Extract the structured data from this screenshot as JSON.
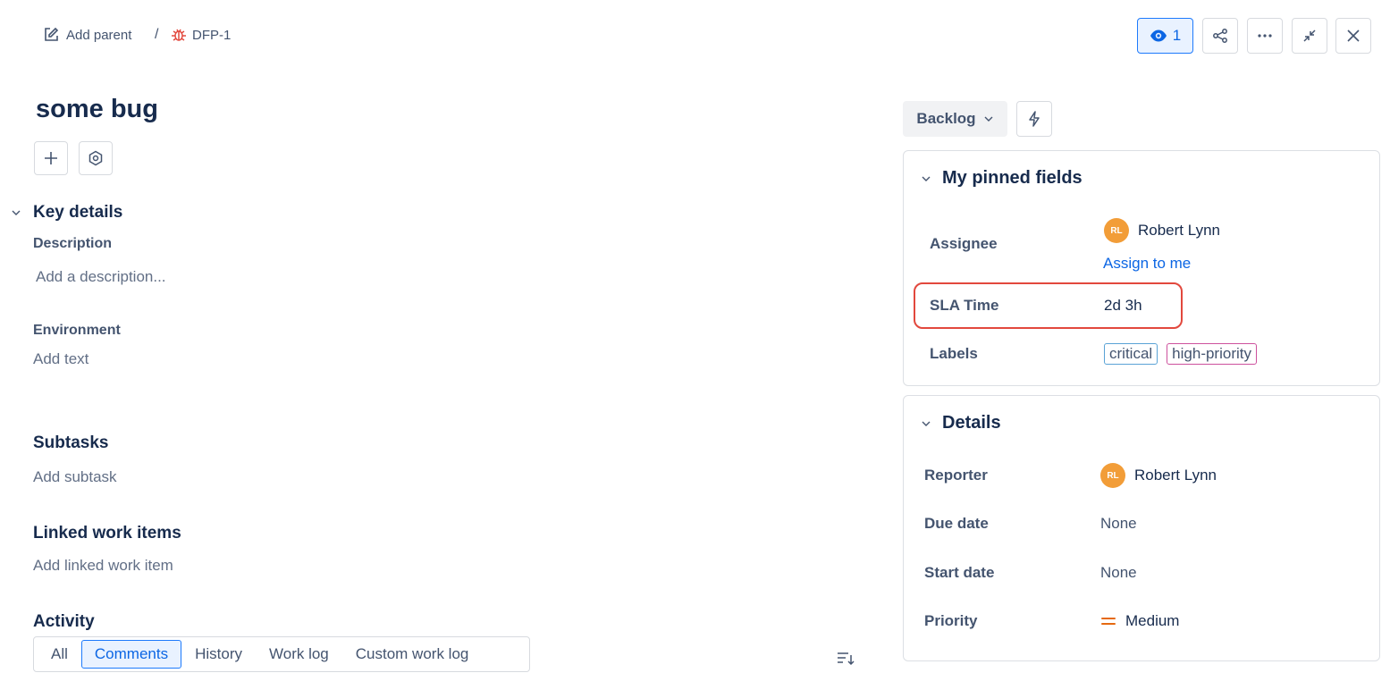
{
  "breadcrumb": {
    "add_parent": "Add parent",
    "separator": "/",
    "issue_key": "DFP-1"
  },
  "toolbar": {
    "watch_count": "1",
    "icons": [
      "eye-icon",
      "share-icon",
      "more-icon",
      "minimize-icon",
      "close-icon"
    ]
  },
  "issue": {
    "title": "some bug"
  },
  "key_details": {
    "heading": "Key details",
    "description_label": "Description",
    "description_placeholder": "Add a description...",
    "environment_label": "Environment",
    "environment_placeholder": "Add text"
  },
  "subtasks": {
    "heading": "Subtasks",
    "action": "Add subtask"
  },
  "linked": {
    "heading": "Linked work items",
    "action": "Add linked work item"
  },
  "activity": {
    "heading": "Activity",
    "tabs": [
      "All",
      "Comments",
      "History",
      "Work log",
      "Custom work log"
    ],
    "active_tab": "Comments"
  },
  "status": {
    "label": "Backlog"
  },
  "pinned": {
    "heading": "My pinned fields",
    "assignee_label": "Assignee",
    "assignee_initials": "RL",
    "assignee_name": "Robert Lynn",
    "assign_to_me": "Assign to me",
    "sla_label": "SLA Time",
    "sla_value": "2d 3h",
    "labels_label": "Labels",
    "labels": [
      "critical",
      "high-priority"
    ]
  },
  "details": {
    "heading": "Details",
    "reporter_label": "Reporter",
    "reporter_initials": "RL",
    "reporter_name": "Robert Lynn",
    "due_label": "Due date",
    "due_value": "None",
    "start_label": "Start date",
    "start_value": "None",
    "priority_label": "Priority",
    "priority_value": "Medium"
  },
  "colors": {
    "accent": "#0c66e4",
    "bug": "#e2483d",
    "avatar": "#f29d38",
    "priority_medium": "#e56910",
    "highlight": "#e2483d"
  }
}
